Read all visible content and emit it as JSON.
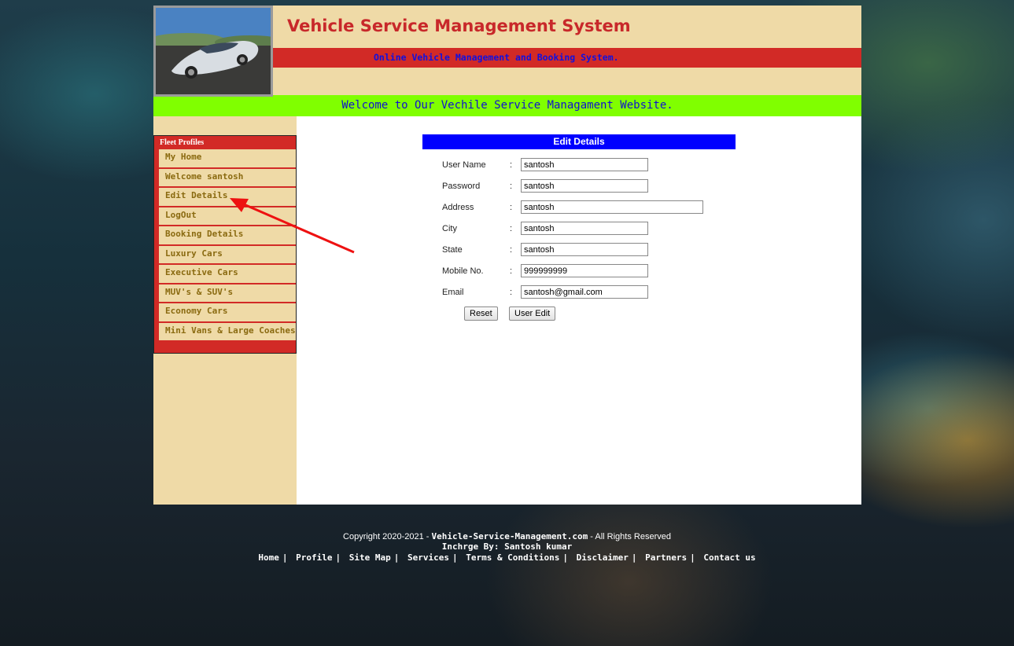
{
  "header": {
    "site_title": "Vehicle Service Management System",
    "tagline": "Online Vehicle Management and Booking System.",
    "welcome": "Welcome to Our Vechile Service Managament Website."
  },
  "sidebar": {
    "heading": "Fleet Profiles",
    "items": [
      {
        "label": "My Home"
      },
      {
        "label": "Welcome santosh"
      },
      {
        "label": "Edit Details"
      },
      {
        "label": "LogOut"
      },
      {
        "label": "Booking Details"
      },
      {
        "label": "Luxury Cars"
      },
      {
        "label": "Executive Cars"
      },
      {
        "label": "MUV's & SUV's"
      },
      {
        "label": "Economy Cars"
      },
      {
        "label": "Mini Vans & Large Coaches"
      }
    ]
  },
  "form": {
    "title": "Edit Details",
    "fields": [
      {
        "label": "User Name",
        "value": "santosh"
      },
      {
        "label": "Password",
        "value": "santosh"
      },
      {
        "label": "Address",
        "value": "santosh"
      },
      {
        "label": "City",
        "value": "santosh"
      },
      {
        "label": "State",
        "value": "santosh"
      },
      {
        "label": "Mobile No.",
        "value": "999999999"
      },
      {
        "label": "Email",
        "value": "santosh@gmail.com"
      }
    ],
    "colon": ":",
    "reset_label": "Reset",
    "submit_label": "User Edit"
  },
  "footer": {
    "copyright_prefix": "Copyright 2020-2021 - ",
    "site": "Vehicle-Service-Management.com",
    "copyright_suffix": " - All Rights Reserved",
    "incharge": "Inchrge By: Santosh kumar",
    "links": [
      "Home",
      "Profile",
      "Site Map",
      "Services",
      "Terms & Conditions",
      "Disclaimer",
      "Partners",
      "Contact us"
    ],
    "separator": "|"
  },
  "colors": {
    "accent_red": "#d22a26",
    "beige": "#efdaa7",
    "welcome_green": "#80ff00",
    "form_title_blue": "#0000ff",
    "annotation_arrow": "#ee1111"
  },
  "annotation": {
    "icon": "red-arrow-icon"
  }
}
